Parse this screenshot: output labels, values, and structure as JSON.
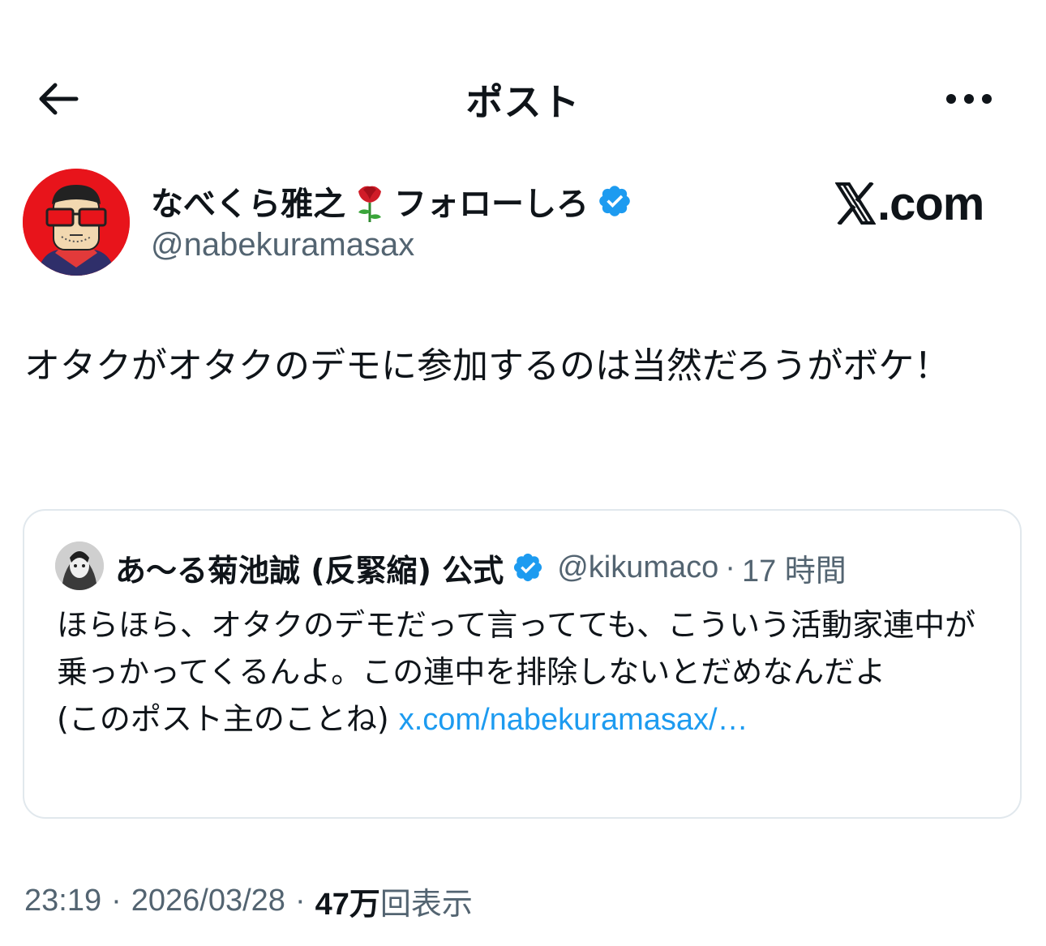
{
  "header": {
    "title": "ポスト",
    "back_icon": "arrow-left-icon",
    "more_icon": "more-horizontal-icon"
  },
  "author": {
    "name_part1": "なべくら雅之",
    "emoji": "rose",
    "name_part2": "フォローしろ",
    "verified": true,
    "handle": "@nabekuramasax"
  },
  "watermark": {
    "logo_text": ".com",
    "logo_icon": "x-logo-icon"
  },
  "post": {
    "text": "オタクがオタクのデモに参加するのは当然だろうがボケ！"
  },
  "quote": {
    "name": "あ〜る菊池誠 (反緊縮) 公式",
    "verified": true,
    "handle": "@kikumaco",
    "separator": "·",
    "time": "17 時間",
    "text": "ほらほら、オタクのデモだって言ってても、こういう活動家連中が乗っかってくるんよ。この連中を排除しないとだめなんだよ",
    "text_line2": "(このポスト主のことね) ",
    "link": "x.com/nabekuramasax/…"
  },
  "meta": {
    "time": "23:19",
    "dot1": "·",
    "date": "2026/03/28",
    "dot2": "·",
    "views_count": "47万",
    "views_label": "回表示"
  },
  "colors": {
    "text_primary": "#0f1419",
    "text_secondary": "#536471",
    "link": "#1d9bf0",
    "verified": "#1d9bf0",
    "border": "#e1e8ed",
    "avatar_bg": "#e8141b"
  }
}
